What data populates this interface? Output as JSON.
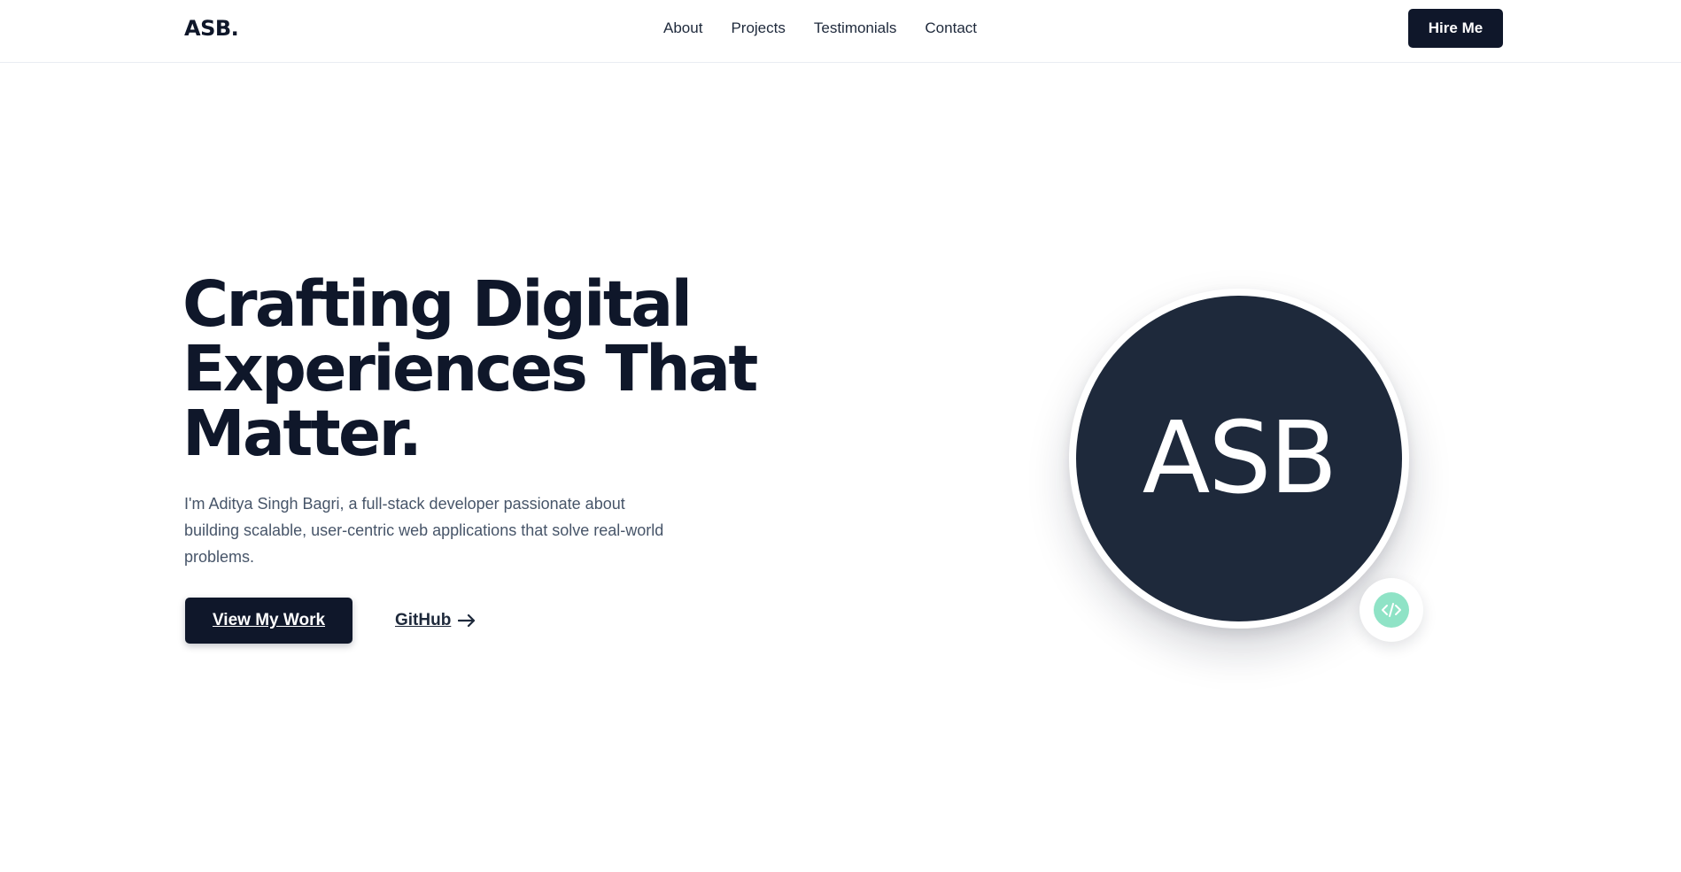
{
  "header": {
    "brand": "ASB.",
    "nav": [
      {
        "label": "About"
      },
      {
        "label": "Projects"
      },
      {
        "label": "Testimonials"
      },
      {
        "label": "Contact"
      }
    ],
    "cta_label": "Hire Me"
  },
  "hero": {
    "headline": [
      "Crafting Digital",
      "Experiences That",
      "Matter."
    ],
    "intro": "I'm Aditya Singh Bagri, a full-stack developer passionate about building scalable, user-centric web applications that solve real-world problems.",
    "primary_cta": "View My Work",
    "secondary_cta": "GitHub",
    "secondary_icon": "arrow-right-icon",
    "avatar_initials": "ASB",
    "badge_icon": "code-icon"
  },
  "colors": {
    "primary": "#0f172a",
    "avatar_bg": "#1e293b",
    "accent": "#8fe3c6",
    "muted_text": "#475569"
  }
}
